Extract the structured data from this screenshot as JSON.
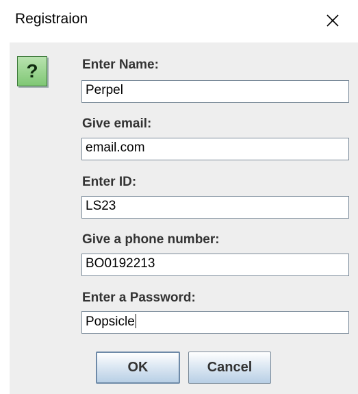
{
  "window": {
    "title": "Registraion",
    "close_icon": "close-x-icon"
  },
  "dialog": {
    "icon": "question-icon",
    "icon_glyph": "?",
    "icon_color": "#8ccf82",
    "fields": [
      {
        "label": "Enter Name:",
        "value": "Perpel"
      },
      {
        "label": "Give email:",
        "value": "email.com"
      },
      {
        "label": "Enter ID:",
        "value": "LS23"
      },
      {
        "label": "Give a phone number:",
        "value": "BO0192213"
      },
      {
        "label": "Enter a Password:",
        "value": "Popsicle"
      }
    ]
  },
  "buttons": {
    "ok_label": "OK",
    "cancel_label": "Cancel"
  }
}
